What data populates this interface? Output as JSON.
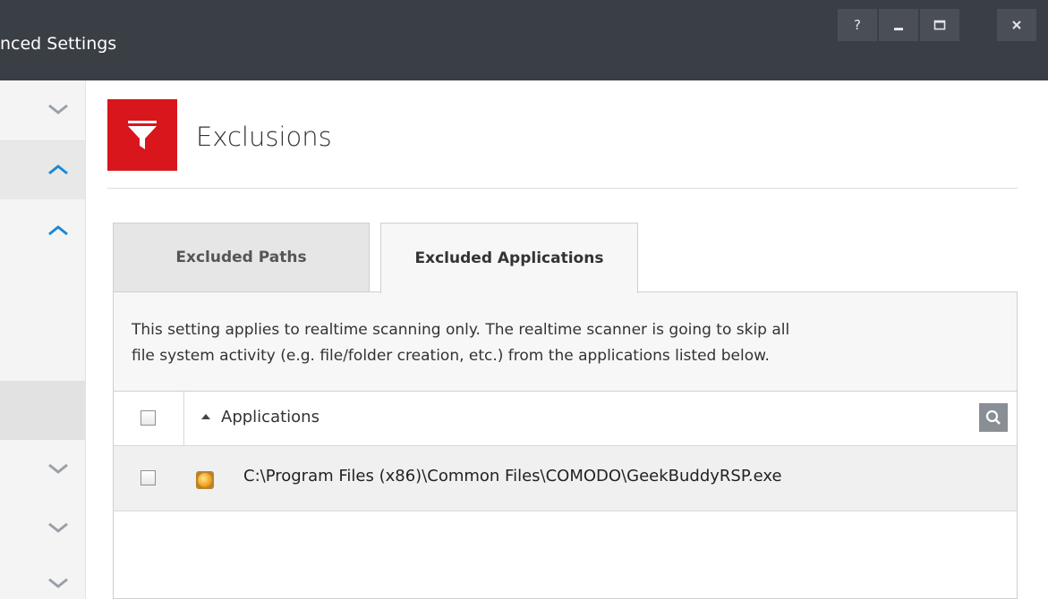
{
  "window": {
    "title": "nced Settings",
    "controls": {
      "help": "?",
      "minimize": "minimize-icon",
      "maximize": "maximize-icon",
      "close": "close-icon"
    }
  },
  "sidebar": {
    "chevrons": [
      "down",
      "up",
      "up",
      "down",
      "down",
      "down"
    ]
  },
  "header": {
    "title": "Exclusions",
    "icon": "filter-icon",
    "icon_color": "#d9161c"
  },
  "tabs": [
    {
      "label": "Excluded Paths",
      "active": false
    },
    {
      "label": "Excluded Applications",
      "active": true
    }
  ],
  "description": {
    "line1": "This setting applies to realtime scanning only. The realtime scanner is going to skip all",
    "line2": "file system activity (e.g. file/folder creation, etc.) from the applications listed below."
  },
  "table": {
    "column_header": "Applications",
    "sort": "ascending",
    "rows": [
      {
        "path": "C:\\Program Files (x86)\\Common Files\\COMODO\\GeekBuddyRSP.exe",
        "checked": false
      }
    ]
  },
  "colors": {
    "titlebar": "#3a3e45",
    "accent_blue": "#1e88d2",
    "brand_red": "#d9161c"
  }
}
